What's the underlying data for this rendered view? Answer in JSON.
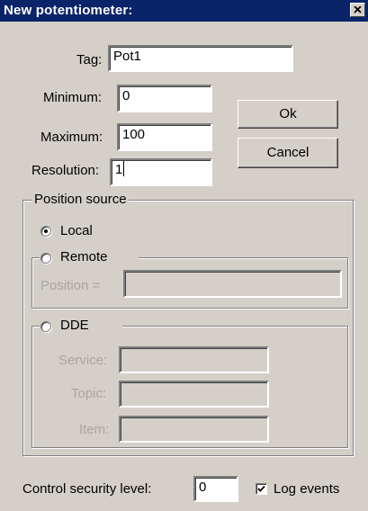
{
  "window": {
    "title": "New potentiometer:",
    "close_icon": "close-icon"
  },
  "fields": {
    "tag": {
      "label": "Tag:",
      "value": "Pot1"
    },
    "minimum": {
      "label": "Minimum:",
      "value": "0"
    },
    "maximum": {
      "label": "Maximum:",
      "value": "100"
    },
    "resolution": {
      "label": "Resolution:",
      "value": "1"
    }
  },
  "buttons": {
    "ok": "Ok",
    "cancel": "Cancel"
  },
  "position_source": {
    "legend": "Position source",
    "local": {
      "label": "Local",
      "selected": true
    },
    "remote": {
      "label": "Remote",
      "selected": false,
      "position_label": "Position =",
      "position_value": ""
    },
    "dde": {
      "label": "DDE",
      "selected": false,
      "service_label": "Service:",
      "service_value": "",
      "topic_label": "Topic:",
      "topic_value": "",
      "item_label": "Item:",
      "item_value": ""
    }
  },
  "security": {
    "label": "Control security level:",
    "value": "0"
  },
  "log_events": {
    "label": "Log events",
    "checked": true
  },
  "colors": {
    "titlebar": "#0a246a",
    "face": "#d4d0c8",
    "disabled_text": "#a9a69f"
  }
}
